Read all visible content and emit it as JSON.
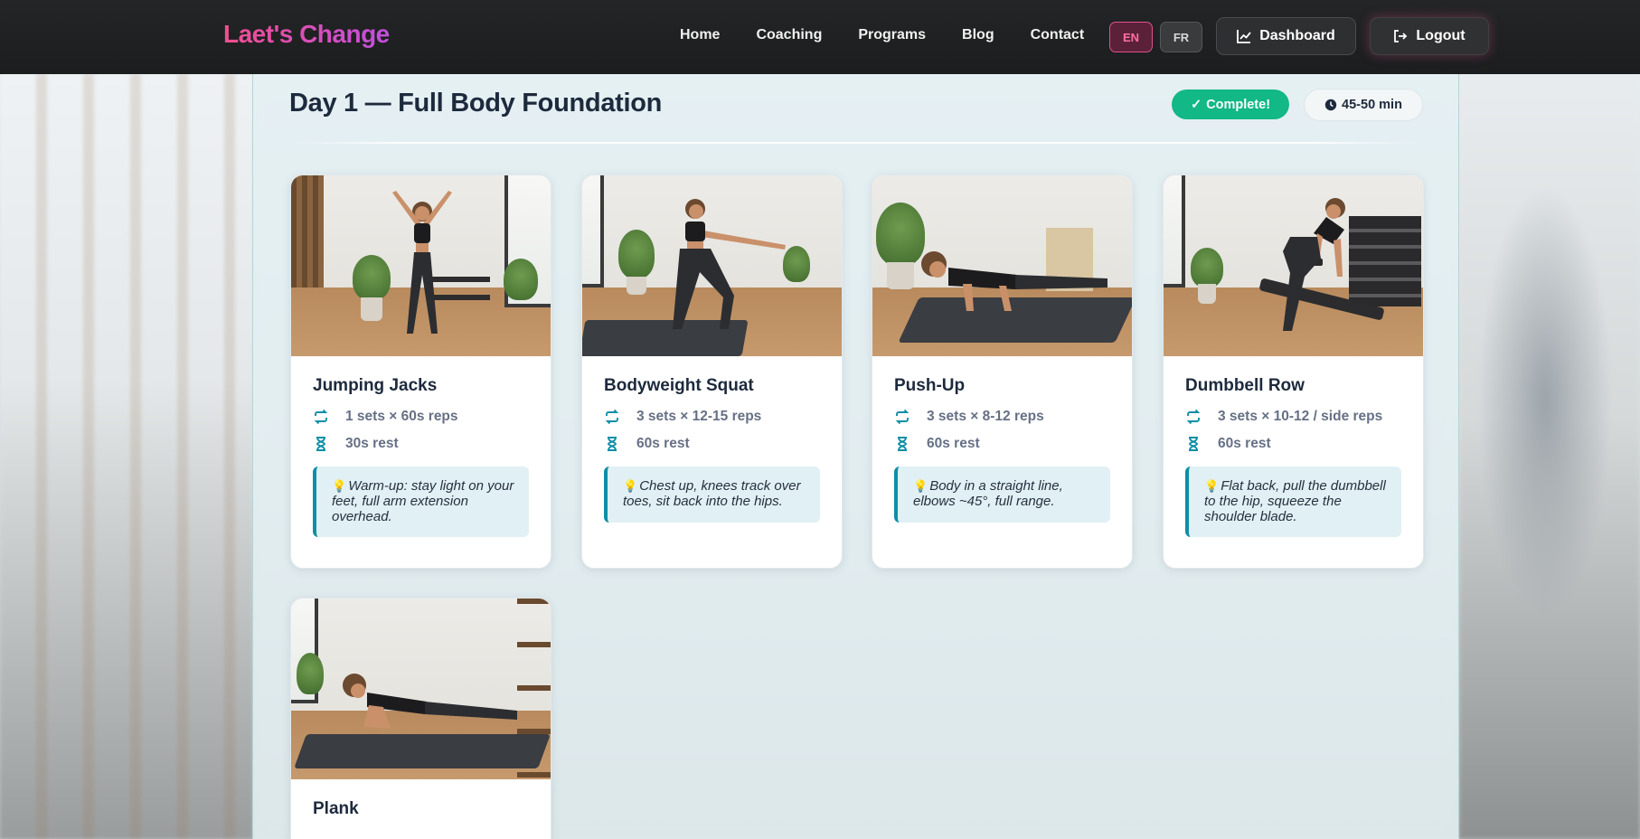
{
  "header": {
    "logo": "Laet's Change",
    "nav": [
      "Home",
      "Coaching",
      "Programs",
      "Blog",
      "Contact"
    ],
    "lang_en": "EN",
    "lang_fr": "FR",
    "dashboard": "Dashboard",
    "logout": "Logout"
  },
  "day": {
    "title": "Day 1 — Full Body Foundation",
    "status": "Complete!",
    "duration": "45-50 min"
  },
  "exercises": [
    {
      "name": "Jumping Jacks",
      "sets": "1 sets × 60s reps",
      "rest": "30s rest",
      "tip": "Warm-up: stay light on your feet, full arm extension overhead."
    },
    {
      "name": "Bodyweight Squat",
      "sets": "3 sets × 12-15 reps",
      "rest": "60s rest",
      "tip": "Chest up, knees track over toes, sit back into the hips."
    },
    {
      "name": "Push-Up",
      "sets": "3 sets × 8-12 reps",
      "rest": "60s rest",
      "tip": "Body in a straight line, elbows ~45°, full range."
    },
    {
      "name": "Dumbbell Row",
      "sets": "3 sets × 10-12 / side reps",
      "rest": "60s rest",
      "tip": "Flat back, pull the dumbbell to the hip, squeeze the shoulder blade."
    },
    {
      "name": "Plank"
    }
  ],
  "colors": {
    "brand_gradient_start": "#f04f8f",
    "brand_gradient_end": "#c24fe0",
    "complete_badge": "#12b886",
    "accent_teal": "#0e8fa6"
  },
  "icons": {
    "sets": "repeat-icon",
    "rest": "hourglass-icon",
    "tip": "lightbulb-icon",
    "duration": "clock-icon",
    "complete": "check-icon",
    "dashboard": "chart-line-icon",
    "logout": "sign-out-icon"
  }
}
